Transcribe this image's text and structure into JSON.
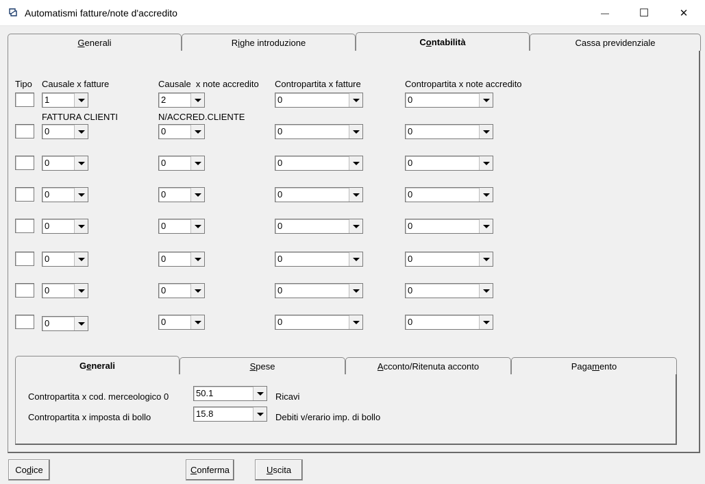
{
  "window": {
    "title": "Automatismi fatture/note d'accredito",
    "minimize_glyph": "—",
    "maximize_glyph": "☐",
    "close_glyph": "✕"
  },
  "tabs": [
    {
      "label": "Generali",
      "underline": "G",
      "rest": "enerali"
    },
    {
      "label": "Righe introduzione",
      "pre": "R",
      "underline": "i",
      "rest": "ghe introduzione"
    },
    {
      "label": "Contabilità",
      "pre": "C",
      "underline": "o",
      "rest": "ntabilità"
    },
    {
      "label": "Cassa previdenziale"
    }
  ],
  "headers": {
    "tipo": "Tipo",
    "causale_fatture": "Causale x fatture",
    "causale_note": "Causale  x note accredito",
    "contropartita_fatture": "Contropartita x fatture",
    "contropartita_note": "Contropartita x note accredito"
  },
  "rows": [
    {
      "causale_fatture": "1",
      "causale_note": "2",
      "contropartita_fatture": "0",
      "contropartita_note": "0"
    },
    {
      "causale_fatture": "0",
      "causale_note": "0",
      "contropartita_fatture": "0",
      "contropartita_note": "0",
      "desc_fatture": "FATTURA CLIENTI",
      "desc_note": "N/ACCRED.CLIENTE"
    },
    {
      "causale_fatture": "0",
      "causale_note": "0",
      "contropartita_fatture": "0",
      "contropartita_note": "0"
    },
    {
      "causale_fatture": "0",
      "causale_note": "0",
      "contropartita_fatture": "0",
      "contropartita_note": "0"
    },
    {
      "causale_fatture": "0",
      "causale_note": "0",
      "contropartita_fatture": "0",
      "contropartita_note": "0"
    },
    {
      "causale_fatture": "0",
      "causale_note": "0",
      "contropartita_fatture": "0",
      "contropartita_note": "0"
    },
    {
      "causale_fatture": "0",
      "causale_note": "0",
      "contropartita_fatture": "0",
      "contropartita_note": "0"
    },
    {
      "causale_fatture": "0",
      "causale_note": "0",
      "contropartita_fatture": "0",
      "contropartita_note": "0"
    }
  ],
  "inner_tabs": [
    {
      "label": "Generali",
      "pre": "G",
      "underline": "e",
      "rest": "nerali"
    },
    {
      "label": "Spese",
      "underline": "S",
      "rest": "pese"
    },
    {
      "label": "Acconto/Ritenuta acconto",
      "underline": "A",
      "rest": "cconto/Ritenuta acconto"
    },
    {
      "label": "Pagamento",
      "pre": "Paga",
      "underline": "m",
      "rest": "ento"
    }
  ],
  "inner_form": {
    "merceologico_label": "Contropartita x cod. merceologico 0",
    "merceologico_value": "50.1",
    "merceologico_desc": "Ricavi",
    "bollo_label": "Contropartita x imposta di bollo",
    "bollo_value": "15.8",
    "bollo_desc": "Debiti v/erario imp. di bollo"
  },
  "buttons": {
    "codice": {
      "label": "Codice",
      "pre": "Co",
      "underline": "d",
      "rest": "ice"
    },
    "conferma": {
      "label": "Conferma",
      "underline": "C",
      "rest": "onferma"
    },
    "uscita": {
      "label": "Uscita",
      "underline": "U",
      "rest": "scita"
    }
  }
}
